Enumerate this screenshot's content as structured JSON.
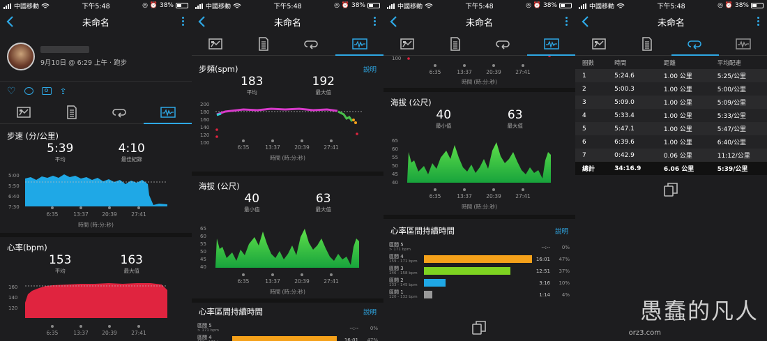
{
  "status": {
    "carrier": "中國移動",
    "time": "下午5:48",
    "battery": "38%"
  },
  "nav": {
    "title": "未命名"
  },
  "screen1": {
    "user_name": "",
    "date_line": "9月10日 @ 6:29 上午 · 跑步",
    "pace": {
      "title": "步速 (分/公里)",
      "avg": "5:39",
      "avg_label": "平均",
      "best": "4:10",
      "best_label": "最佳紀錄",
      "yticks": [
        "5:00",
        "5:50",
        "6:40",
        "7:30"
      ]
    },
    "hr": {
      "title": "心率(bpm)",
      "avg": "153",
      "avg_label": "平均",
      "max": "163",
      "max_label": "最大值",
      "yticks": [
        "160",
        "140",
        "120"
      ]
    }
  },
  "screen2": {
    "cadence": {
      "title": "步頻(spm)",
      "link": "說明",
      "avg": "183",
      "avg_label": "平均",
      "max": "192",
      "max_label": "最大值",
      "yticks": [
        "200",
        "180",
        "160",
        "140",
        "120",
        "100"
      ]
    },
    "elev": {
      "title": "海拔 (公尺)",
      "min": "40",
      "min_label": "最小值",
      "max": "63",
      "max_label": "最大值",
      "yticks": [
        "65",
        "60",
        "55",
        "50",
        "45",
        "40"
      ]
    },
    "hrzone": {
      "title": "心率區間持續時間",
      "link": "說明"
    }
  },
  "screen3": {
    "elev": {
      "title": "海拔 (公尺)",
      "min": "40",
      "min_label": "最小值",
      "max": "63",
      "max_label": "最大值",
      "yticks": [
        "65",
        "60",
        "55",
        "50",
        "45",
        "40"
      ]
    },
    "hrzone": {
      "title": "心率區間持續時間",
      "link": "說明"
    }
  },
  "xaxis": {
    "ticks": [
      "6:35",
      "13:37",
      "20:39",
      "27:41"
    ],
    "unit": "時間 (時:分:秒)"
  },
  "zones": [
    {
      "name": "區間 5",
      "range": "> 171 bpm",
      "time": "--:--",
      "pct": "0%",
      "frac": 0,
      "color": "#999999"
    },
    {
      "name": "區間 4",
      "range": "159 - 171 bpm",
      "time": "16:01",
      "pct": "47%",
      "frac": 1.0,
      "color": "#f5a11a"
    },
    {
      "name": "區間 3",
      "range": "146 - 158 bpm",
      "time": "12:51",
      "pct": "37%",
      "frac": 0.8,
      "color": "#7ed321"
    },
    {
      "name": "區間 2",
      "range": "133 - 145 bpm",
      "time": "3:16",
      "pct": "10%",
      "frac": 0.2,
      "color": "#1fa8e6"
    },
    {
      "name": "區間 1",
      "range": "120 - 132 bpm",
      "time": "1:14",
      "pct": "4%",
      "frac": 0.08,
      "color": "#999999"
    }
  ],
  "laps": {
    "headers": [
      "圈數",
      "時間",
      "距離",
      "平均配速"
    ],
    "rows": [
      [
        "1",
        "5:24.6",
        "1.00 公里",
        "5:25/公里"
      ],
      [
        "2",
        "5:00.3",
        "1.00 公里",
        "5:00/公里"
      ],
      [
        "3",
        "5:09.0",
        "1.00 公里",
        "5:09/公里"
      ],
      [
        "4",
        "5:33.4",
        "1.00 公里",
        "5:33/公里"
      ],
      [
        "5",
        "5:47.1",
        "1.00 公里",
        "5:47/公里"
      ],
      [
        "6",
        "6:39.6",
        "1.00 公里",
        "6:40/公里"
      ],
      [
        "7",
        "0:42.9",
        "0.06 公里",
        "11:12/公里"
      ]
    ],
    "total": [
      "總計",
      "34:16.9",
      "6.06 公里",
      "5:39/公里"
    ]
  },
  "watermark": {
    "text": "愚蠢的凡人",
    "site": "orz3.com"
  }
}
